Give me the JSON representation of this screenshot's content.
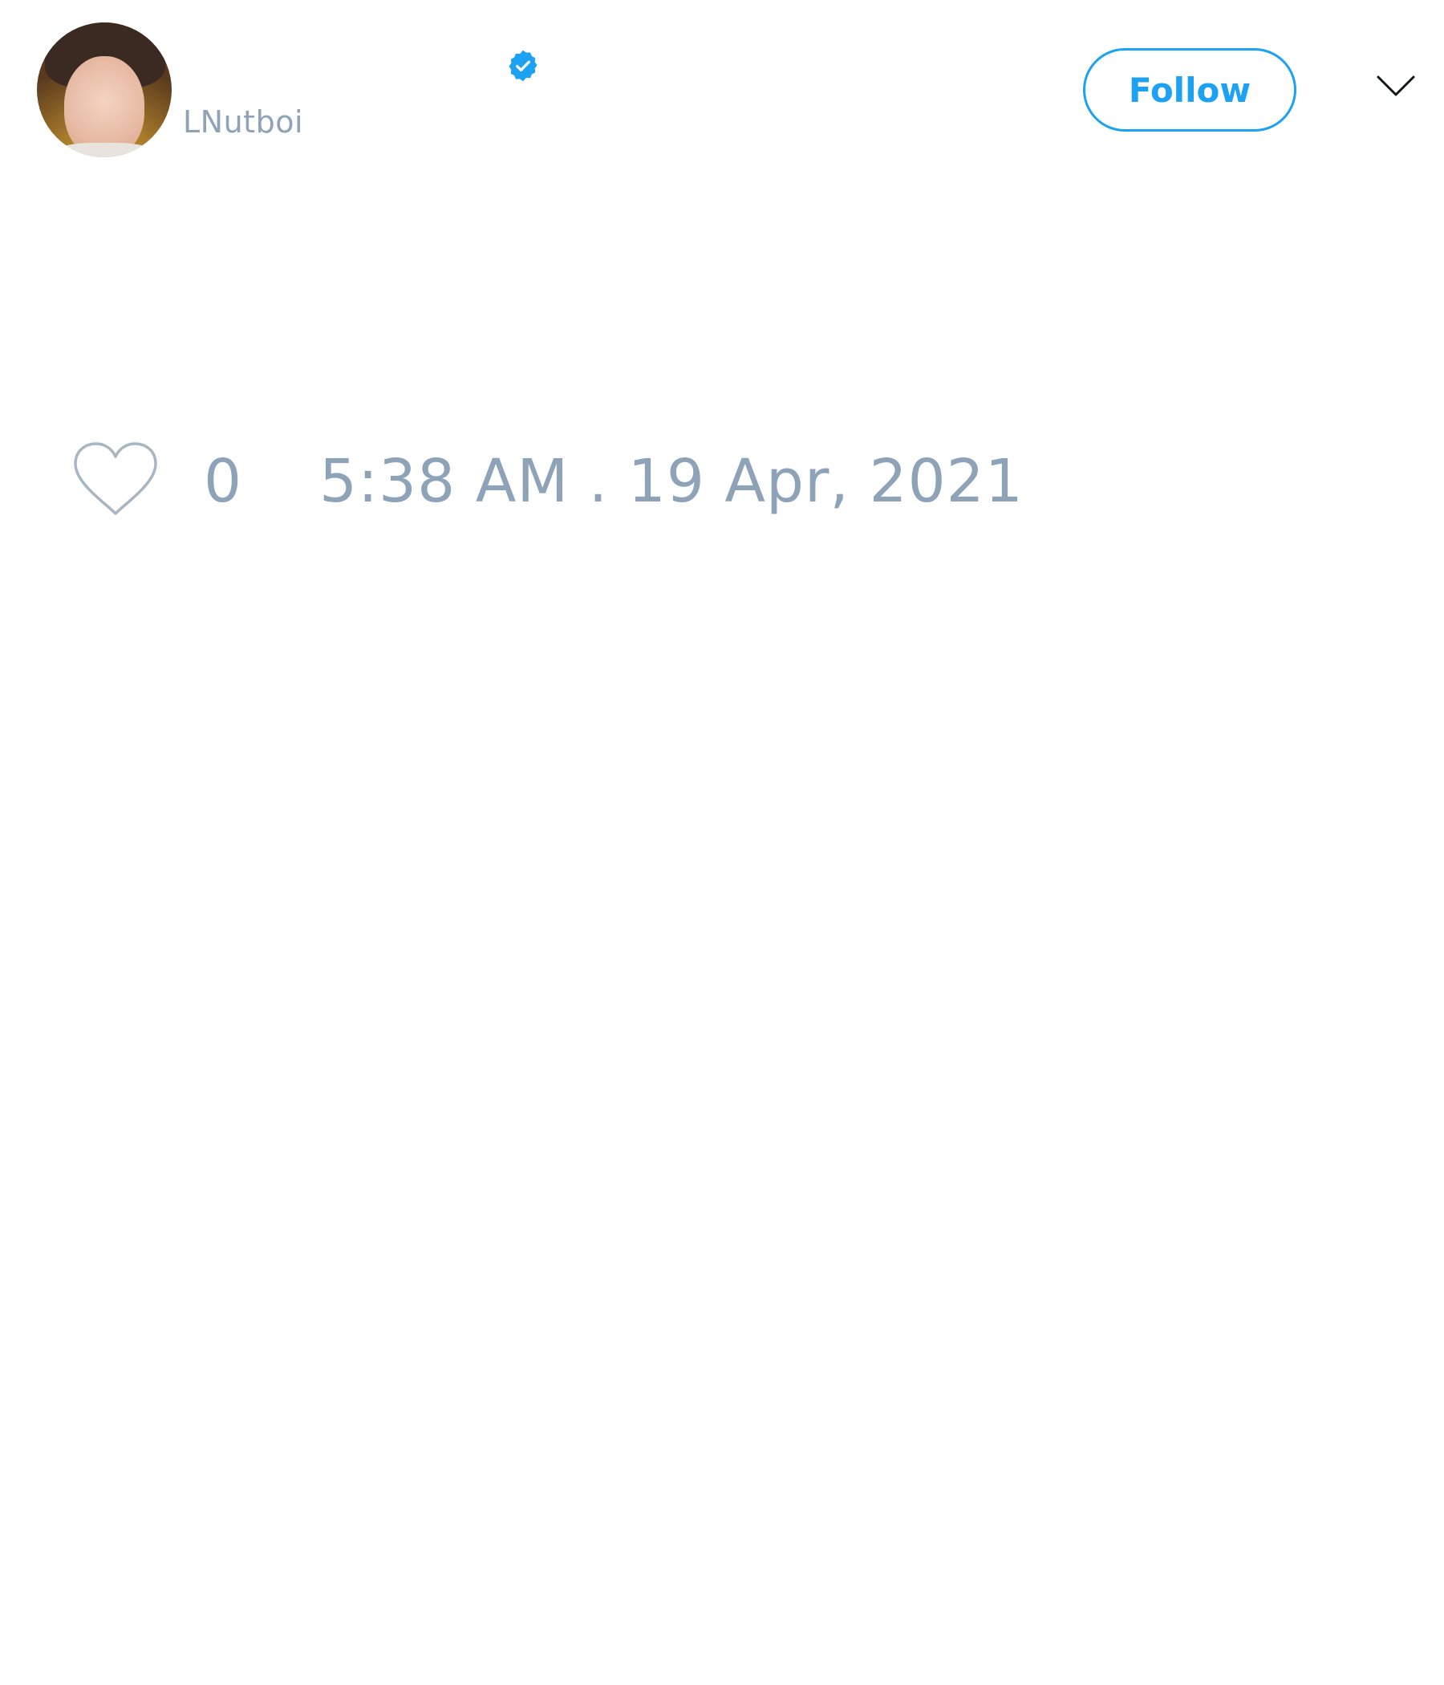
{
  "tweet": {
    "author": {
      "display_name": "",
      "handle": "LNutboi",
      "verified": true,
      "avatar_icon": "profile-photo"
    },
    "follow_label": "Follow",
    "menu_icon": "chevron-down-icon",
    "like_icon": "heart-icon",
    "like_count": "0",
    "timestamp": "5:38 AM . 19 Apr, 2021"
  },
  "colors": {
    "accent": "#1da1f2",
    "muted_text": "#8fa3b8",
    "background": "#ffffff"
  }
}
